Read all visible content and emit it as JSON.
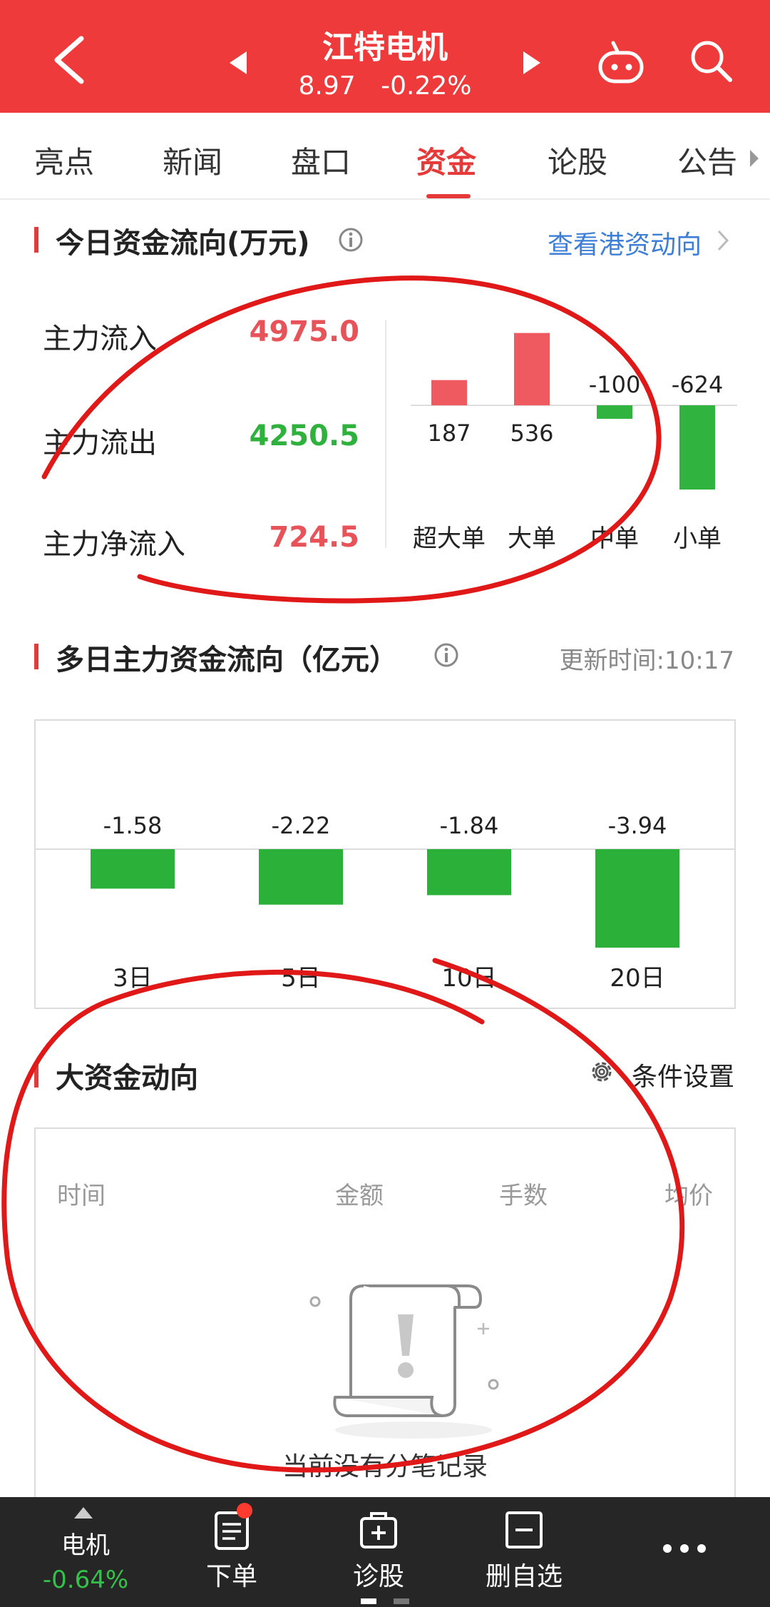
{
  "header": {
    "stock_name": "江特电机",
    "price": "8.97",
    "change_pct": "-0.22%"
  },
  "tabs": [
    {
      "label": "亮点"
    },
    {
      "label": "新闻"
    },
    {
      "label": "盘口"
    },
    {
      "label": "资金",
      "active": true
    },
    {
      "label": "论股"
    },
    {
      "label": "公告"
    }
  ],
  "today_flow": {
    "title": "今日资金流向(万元)",
    "link": "查看港资动向",
    "rows": [
      {
        "label": "主力流入",
        "value": "4975.0",
        "color": "#e8535a"
      },
      {
        "label": "主力流出",
        "value": "4250.5",
        "color": "#2fb13d"
      },
      {
        "label": "主力净流入",
        "value": "724.5",
        "color": "#e8535a"
      }
    ]
  },
  "chart_data": [
    {
      "type": "bar",
      "categories": [
        "超大单",
        "大单",
        "中单",
        "小单"
      ],
      "values": [
        187,
        536,
        -100,
        -624
      ],
      "value_labels": [
        "187",
        "536",
        "-100",
        "-624"
      ],
      "colors": {
        "positive": "#ee5a5f",
        "negative": "#30b43f"
      }
    },
    {
      "type": "bar",
      "categories": [
        "3日",
        "5日",
        "10日",
        "20日"
      ],
      "values": [
        -1.58,
        -2.22,
        -1.84,
        -3.94
      ],
      "value_labels": [
        "-1.58",
        "-2.22",
        "-1.84",
        "-3.94"
      ],
      "colors": {
        "positive": "#ee5a5f",
        "negative": "#2bb13a"
      }
    }
  ],
  "multi_day": {
    "title": "多日主力资金流向（亿元）",
    "update_time": "更新时间:10:17"
  },
  "big_money": {
    "title": "大资金动向",
    "settings_label": "条件设置",
    "columns": [
      "时间",
      "金额",
      "手数",
      "均价"
    ],
    "empty_text": "当前没有分笔记录"
  },
  "bottom_bar": {
    "market_name": "电机",
    "market_change": "-0.64%",
    "order_label": "下单",
    "diagnose_label": "诊股",
    "remove_watch_label": "删自选"
  }
}
